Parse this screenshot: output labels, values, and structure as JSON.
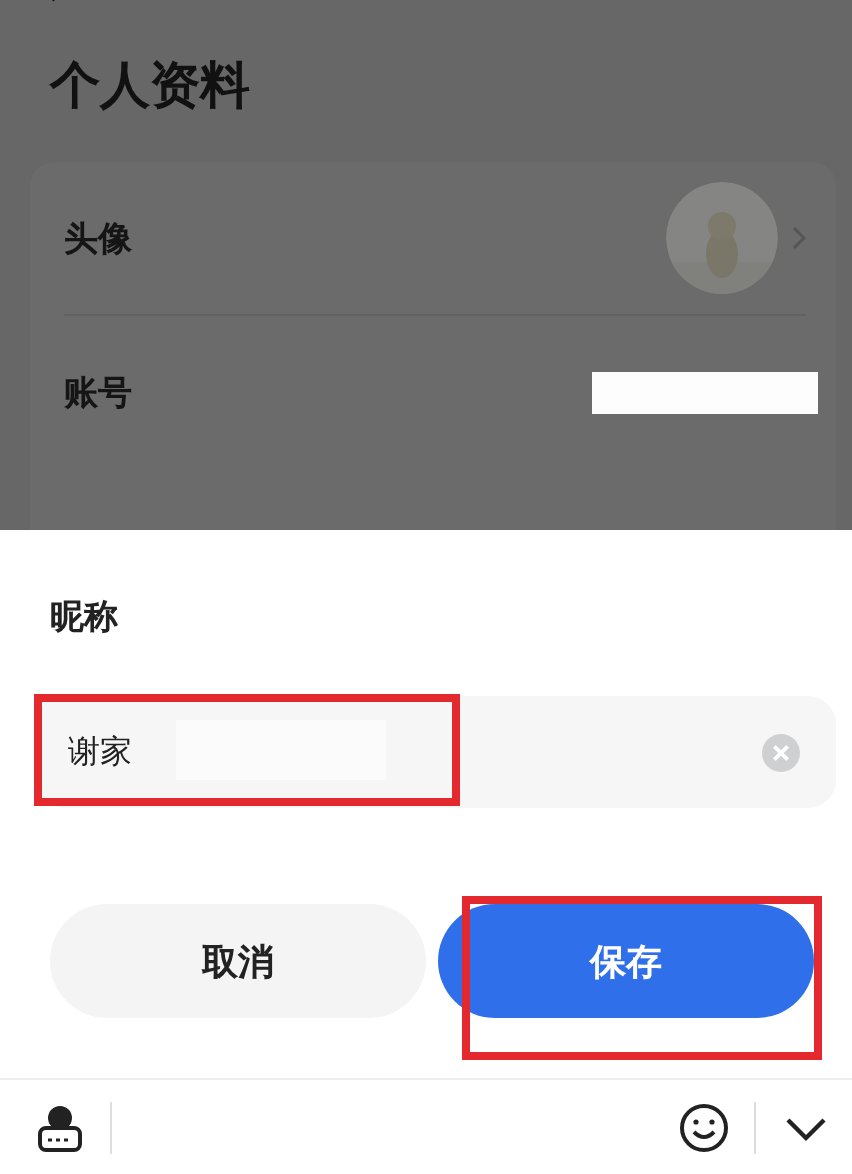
{
  "page": {
    "title": "个人资料",
    "rows": [
      {
        "label": "头像",
        "kind": "avatar"
      },
      {
        "label": "账号",
        "kind": "redacted"
      }
    ]
  },
  "sheet": {
    "title": "昵称",
    "field": {
      "value": "谢家"
    },
    "buttons": [
      {
        "label": "取消",
        "kind": "secondary"
      },
      {
        "label": "保存",
        "kind": "primary"
      }
    ]
  }
}
